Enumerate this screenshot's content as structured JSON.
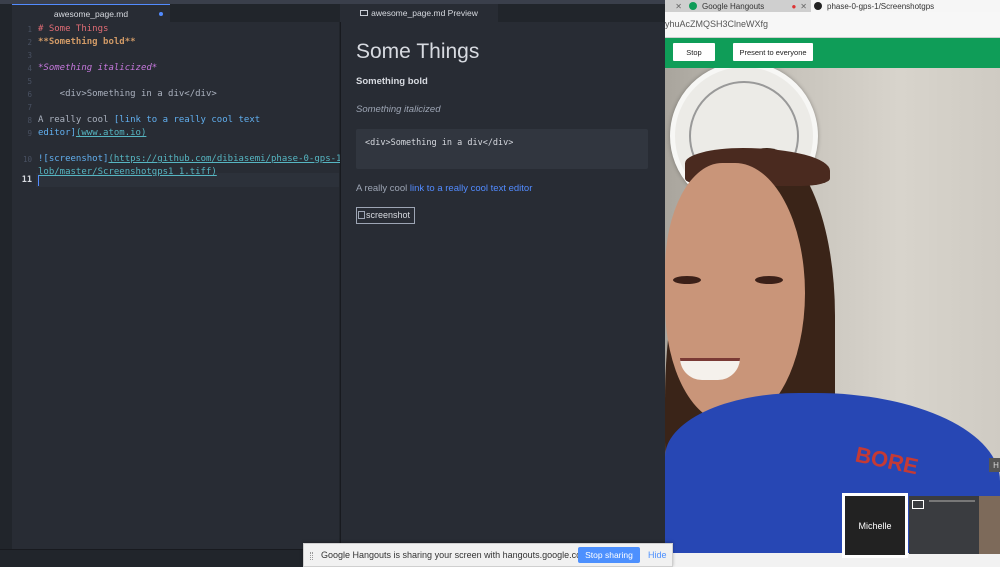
{
  "atom": {
    "tab_editor": "awesome_page.md",
    "tab_preview": "awesome_page.md Preview",
    "line_numbers": [
      "1",
      "2",
      "3",
      "4",
      "5",
      "6",
      "7",
      "8",
      "9",
      "10",
      "11"
    ],
    "code": {
      "l1": "# Some Things",
      "l2": "**Something bold**",
      "l4": "*Something italicized*",
      "l6": "    <div>Something in a div</div>",
      "l8a": "A really cool ",
      "l8b": "[link to a really cool text",
      "l9a": "editor]",
      "l9b": "(www.atom.io)",
      "l11a": "![screenshot]",
      "l11b": "(https://github.com/dibiasemi/phase-0-gps-1/b",
      "l12": "lob/master/Screenshotgps1_1.tiff)"
    },
    "preview": {
      "heading": "Some Things",
      "bold": "Something bold",
      "italic": "Something italicized",
      "code_block": "<div>Something in a div</div>",
      "para_prefix": "A really cool ",
      "link_text": "link to a really cool text editor",
      "image_alt": "screenshot"
    }
  },
  "browser": {
    "tab_google_hangouts": "Google Hangouts",
    "tab_github": "phase-0-gps-1/Screenshotgps",
    "url_fragment": "yhuAcZMQSH3ClneWXfg",
    "stop_button": "Stop",
    "present_button": "Present to everyone",
    "shirt_text": "BORE",
    "participant_name": "Michelle",
    "edge_label": "H"
  },
  "sharebar": {
    "message": "Google Hangouts is sharing your screen with hangouts.google.com.",
    "stop_sharing": "Stop sharing",
    "hide": "Hide"
  },
  "colors": {
    "hangouts_green": "#0f9d58",
    "atom_accent": "#528bff",
    "stop_sharing_blue": "#4d90fe"
  }
}
